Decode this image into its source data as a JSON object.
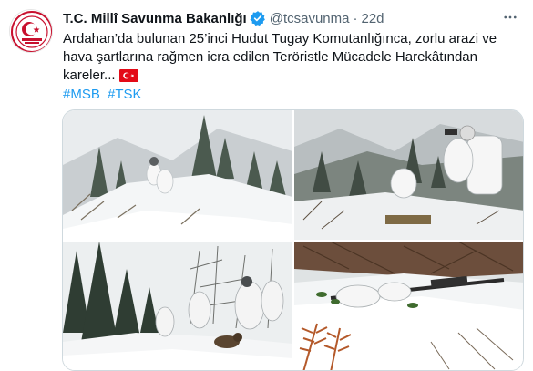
{
  "tweet": {
    "display_name": "T.C. Millî Savunma Bakanlığı",
    "handle": "@tcsavunma",
    "separator": "·",
    "time": "22d",
    "text": "Ardahan’da bulunan 25’inci Hudut Tugay Komutanlığınca, zorlu arazi ve hava şartlarına rağmen icra edilen Teröristle Mücadele Harekâtından kareler...",
    "hashtags": [
      "#MSB",
      "#TSK"
    ]
  },
  "icons": {
    "avatar": "msb-seal-logo",
    "verified": "verified-badge-icon",
    "more": "more-options-icon",
    "flag": "turkey-flag-icon"
  },
  "colors": {
    "accent": "#1d9bf0",
    "text": "#0f1419",
    "secondary": "#536471",
    "flag_red": "#e30a17"
  }
}
